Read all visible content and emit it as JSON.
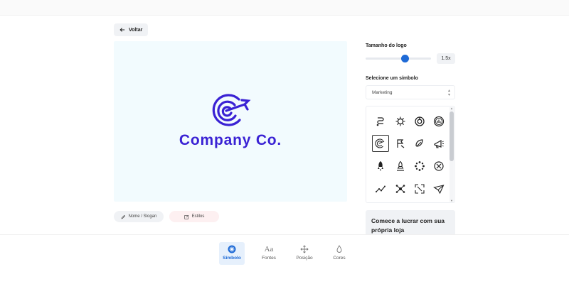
{
  "header": {
    "back_label": "Voltar"
  },
  "preview": {
    "company_name": "Company Co.",
    "logo_color": "#3a22d4",
    "background_color": "#f2fbfe"
  },
  "actions": {
    "name_slogan_label": "Nome / Slogan",
    "styles_label": "Estilos"
  },
  "panel": {
    "size_label": "Tamanho do logo",
    "size_value": "1.5x",
    "size_fraction": 0.6,
    "symbol_label": "Selecione um símbolo",
    "category_selected": "Marketing",
    "selected_icon": "target-arrow-icon"
  },
  "promo": {
    "text": "Comece a lucrar com sua própria loja"
  },
  "bottom_tabs": [
    {
      "label": "Símbolo",
      "icon": "symbol-icon",
      "active": true
    },
    {
      "label": "Fontes",
      "icon": "fonts-icon",
      "active": false
    },
    {
      "label": "Posição",
      "icon": "position-icon",
      "active": false
    },
    {
      "label": "Cores",
      "icon": "colors-icon",
      "active": false
    }
  ],
  "accent_color": "#1e6ad6"
}
